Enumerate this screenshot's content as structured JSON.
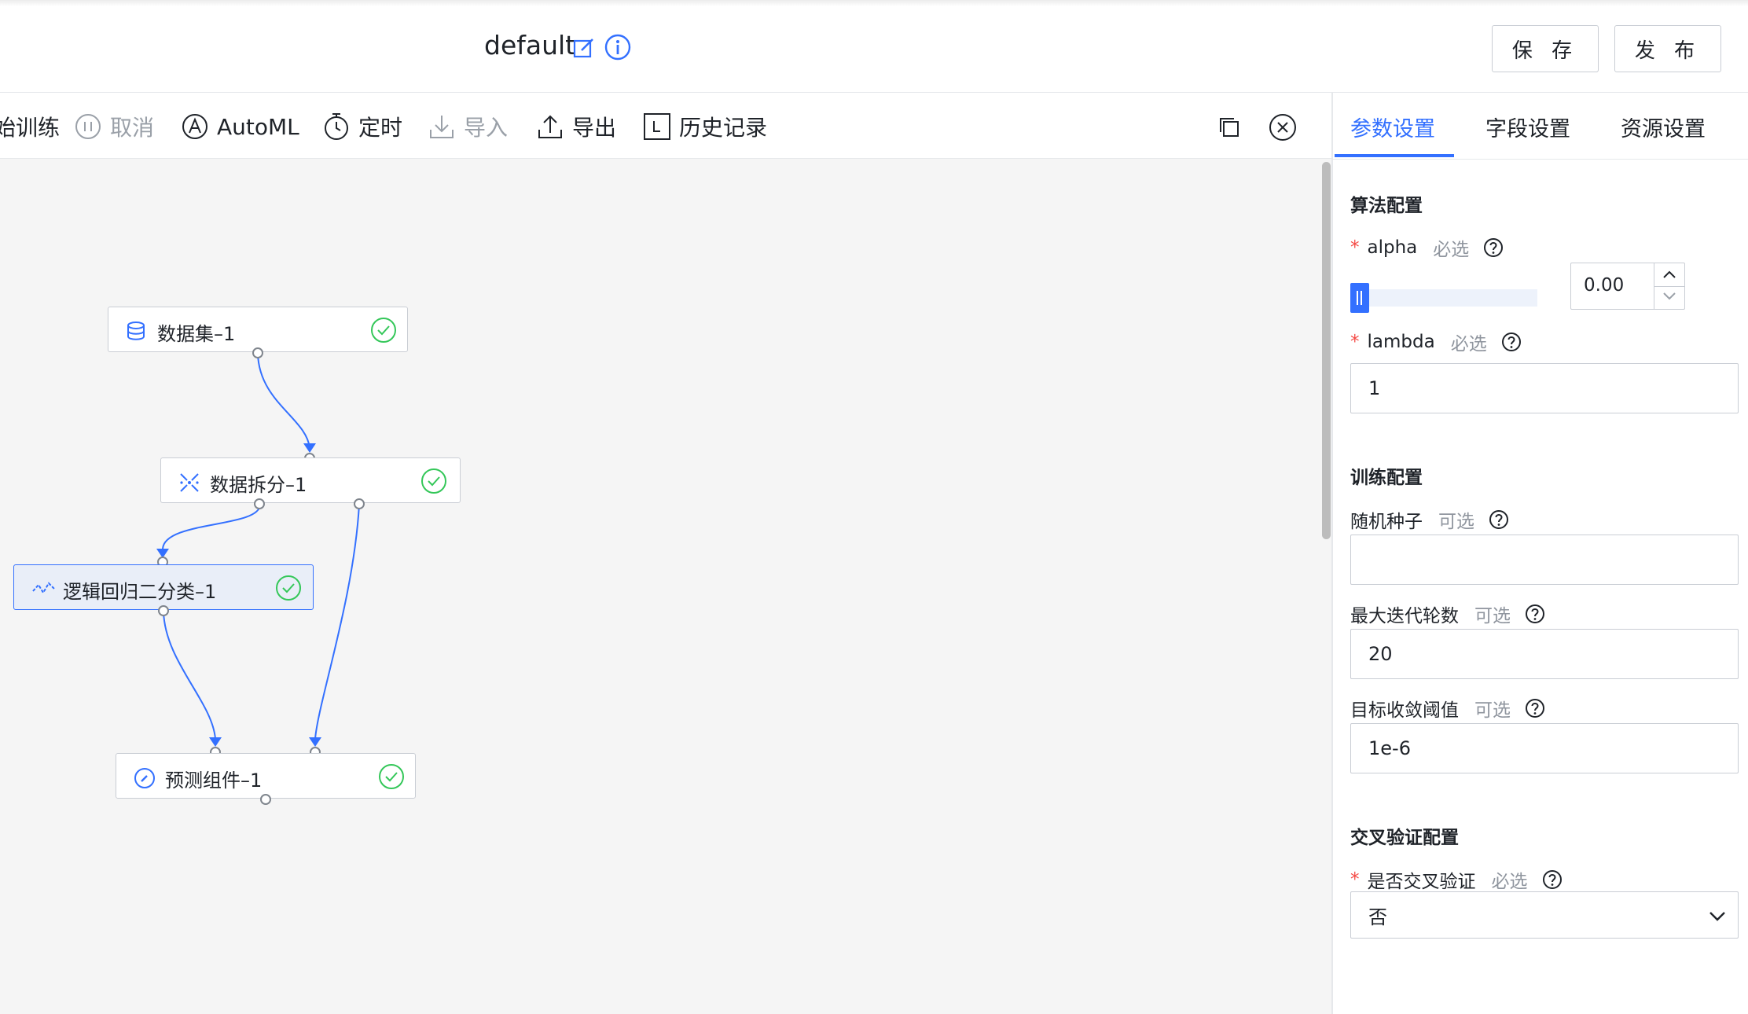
{
  "header": {
    "title": "default",
    "save_label": "保 存",
    "publish_label": "发 布"
  },
  "toolbar": {
    "train_label": "始训练",
    "cancel_label": "取消",
    "automl_label": "AutoML",
    "schedule_label": "定时",
    "import_label": "导入",
    "export_label": "导出",
    "history_label": "历史记录"
  },
  "canvas": {
    "nodes": [
      {
        "label": "数据集–1",
        "icon": "database-icon",
        "status": "success"
      },
      {
        "label": "数据拆分–1",
        "icon": "split-icon",
        "status": "success"
      },
      {
        "label": "逻辑回归二分类–1",
        "icon": "regression-icon",
        "status": "success",
        "selected": true
      },
      {
        "label": "预测组件–1",
        "icon": "predict-icon",
        "status": "success"
      }
    ]
  },
  "panel": {
    "tabs": [
      {
        "label": "参数设置",
        "active": true
      },
      {
        "label": "字段设置",
        "active": false
      },
      {
        "label": "资源设置",
        "active": false
      }
    ],
    "algo_section": "算法配置",
    "alpha": {
      "label": "alpha",
      "tag": "必选",
      "value": "0.00",
      "slider_fraction": 0.0
    },
    "lambda": {
      "label": "lambda",
      "tag": "必选",
      "value": "1"
    },
    "train_section": "训练配置",
    "seed": {
      "label": "随机种子",
      "tag": "可选",
      "value": ""
    },
    "max_iter": {
      "label": "最大迭代轮数",
      "tag": "可选",
      "value": "20"
    },
    "tol": {
      "label": "目标收敛阈值",
      "tag": "可选",
      "value": "1e-6"
    },
    "cv_section": "交叉验证配置",
    "cv": {
      "label": "是否交叉验证",
      "tag": "必选",
      "value": "否"
    }
  },
  "colors": {
    "accent": "#3370ff",
    "success": "#34c759",
    "required": "#f54a45"
  }
}
